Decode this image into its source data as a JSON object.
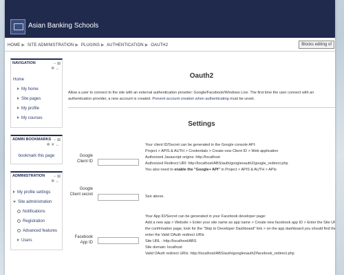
{
  "site": {
    "name": "Asian Banking Schools"
  },
  "breadcrumb": [
    "HOME",
    "SITE ADMINISTRATION",
    "PLUGINS",
    "AUTHENTICATION",
    "OAUTH2"
  ],
  "blocks_button": "Blocks editing of",
  "navigation": {
    "title": "NAVIGATION",
    "items": [
      "Home",
      "My home",
      "Site pages",
      "My profile",
      "My courses"
    ]
  },
  "admin_bookmarks": {
    "title": "ADMIN BOOKMARKS",
    "link": "bookmark this page"
  },
  "administration": {
    "title": "ADMINISTRATION",
    "items": [
      "My profile settings",
      "Site administration",
      "Notifications",
      "Registration",
      "Advanced features",
      "Users"
    ]
  },
  "main": {
    "title": "Oauth2",
    "description_part1": "Allow a user to connect to the site with an external authentication provider: Google/Facebook/Windows Live. The first time the user connect with an authentication provider, a new account is created.",
    "description_part2": "Prevent account creation when authenticating",
    "description_part3": " must be unset.",
    "settings_title": "Settings"
  },
  "fields": {
    "google_client_id": {
      "label": "Google Client ID",
      "help": [
        "Your client ID/Secret can be generated in the Google console API:",
        "Project > APIS & AUTH > Credentials > Create new Client ID > Web application",
        "Authorized Javascript origins: http://localhost",
        "Authorized Redirect URI: http://localhost/ABS/auth/googleoauth2/google_redirect.php"
      ],
      "help_bold_prefix": "You also need to ",
      "help_bold": "enable the \"Google+ API\"",
      "help_bold_suffix": " in Project > APIS & AUTH > APIs"
    },
    "google_client_secret": {
      "label": "Google Client secret",
      "help": "See above."
    },
    "facebook_app_id": {
      "label": "Facebook App ID",
      "help": [
        "Your App ID/Secret can be generated in your Facebook developer page:",
        "Add a new app > Website > Enter your site name as app name > Create new facebook app ID > Enter the Site URL - n",
        "the confirmation page, look for the \"Skip to Developer Dashboard\" link > on the app dashboard you should find the id/se",
        "enter the Valid OAuth redirect URIs",
        "Site URL : http://localhost/ABS",
        "Site domain: localhost",
        "Valid OAuth redirect URIs: http://localhost/ABS/auth/googleoauth2/facebook_redirect.php"
      ]
    }
  }
}
